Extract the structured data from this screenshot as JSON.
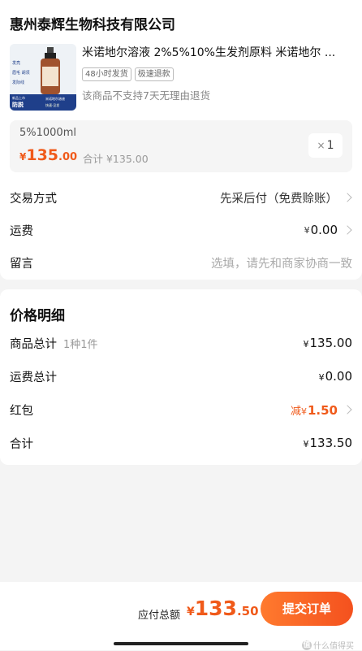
{
  "shop": {
    "name": "惠州泰辉生物科技有限公司"
  },
  "product": {
    "title": "米诺地尔溶液 2%5%10%生发剂原料 米诺地尔 ...",
    "tags": [
      "48小时发货",
      "极速退款"
    ],
    "note": "该商品不支持7天无理由退货",
    "image_text": {
      "line1": "发亮",
      "line2": "眉毛 胡须",
      "line3": "发际线",
      "badge_top": "新品上市",
      "badge": "防脱",
      "right_top": "米诺地尔溶液",
      "right_bottom": "快速·见发"
    },
    "sku": {
      "spec": "5%1000ml",
      "price_yen": "¥",
      "price_int": "135",
      "price_dec": ".00",
      "subtotal": "合计 ¥135.00",
      "qty_symbol": "×",
      "qty": "1"
    }
  },
  "order_rows": {
    "trade": {
      "label": "交易方式",
      "value": "先采后付（免费赊账）"
    },
    "shipping": {
      "label": "运费",
      "yen": "¥",
      "value": "0.00"
    },
    "message": {
      "label": "留言",
      "placeholder": "选填，请先和商家协商一致"
    }
  },
  "price_detail": {
    "title": "价格明细",
    "goods_total": {
      "label": "商品总计",
      "sub": "1种1件",
      "yen": "¥",
      "value": "135.00"
    },
    "shipping_total": {
      "label": "运费总计",
      "yen": "¥",
      "value": "0.00"
    },
    "red_packet": {
      "label": "红包",
      "prefix": "减",
      "yen": "¥",
      "value": "1.50"
    },
    "total": {
      "label": "合计",
      "yen": "¥",
      "value": "133.50"
    }
  },
  "bottom": {
    "pay_label": "应付总额",
    "pay_yen": "¥",
    "pay_int": "133",
    "pay_dec": ".50",
    "submit": "提交订单",
    "watermark": "什么值得买"
  },
  "colors": {
    "accent": "#f05a1a",
    "button_gradient_start": "#ff7a2e",
    "button_gradient_end": "#f4511e"
  }
}
